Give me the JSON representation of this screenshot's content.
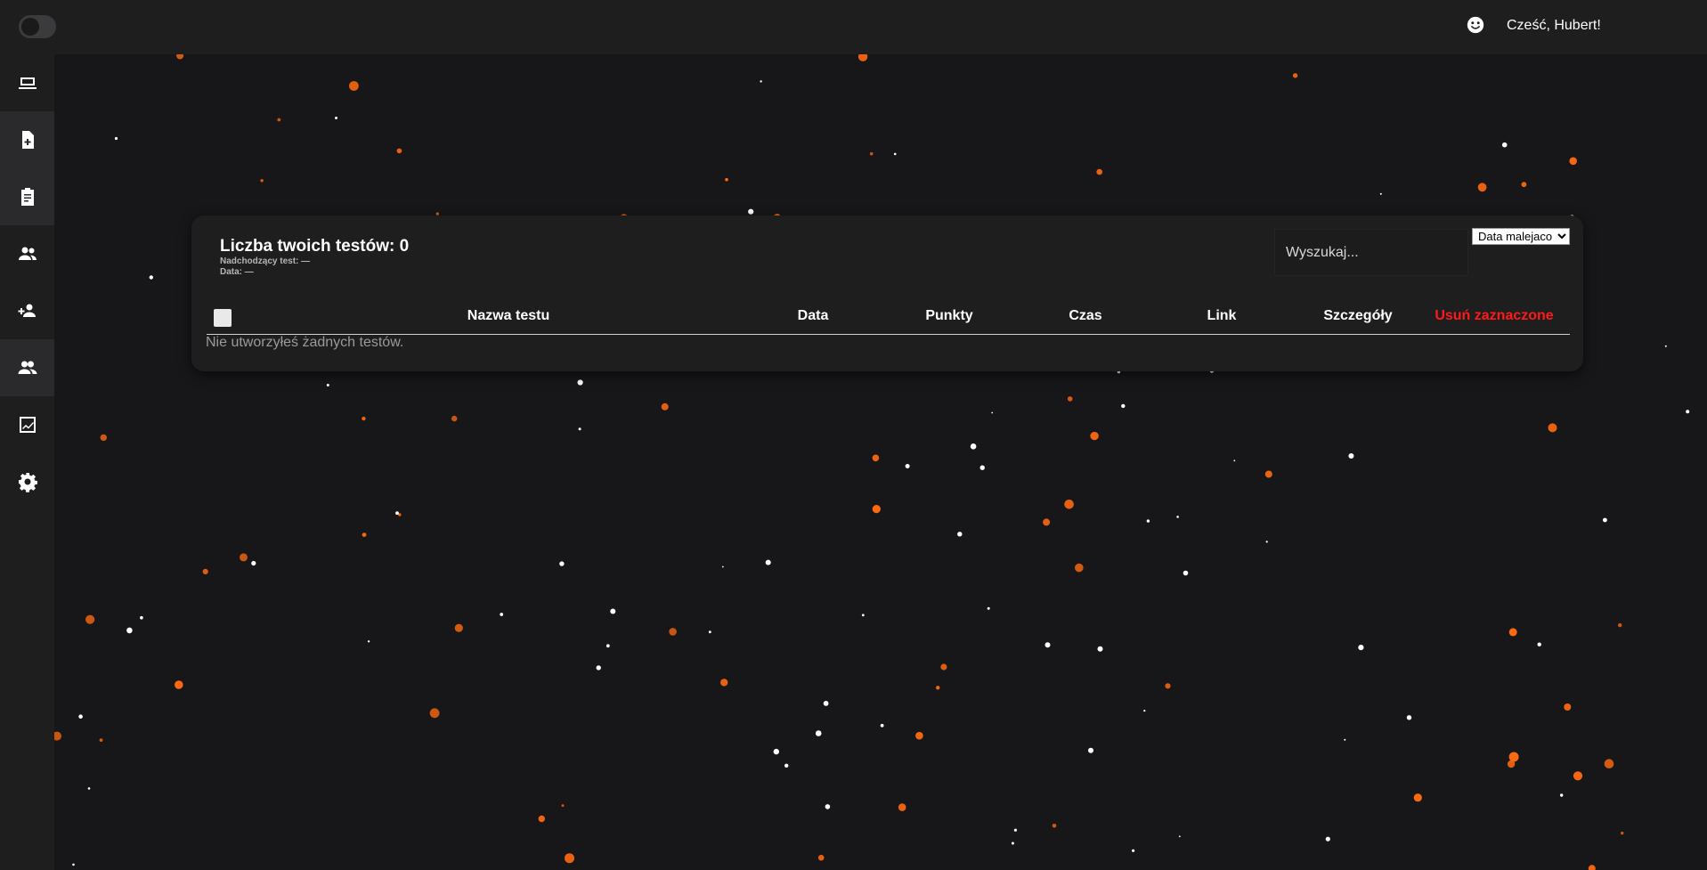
{
  "header": {
    "greeting": "Cześć, Hubert!"
  },
  "sidebar": {
    "items": [
      {
        "name": "dashboard",
        "icon": "laptop-icon"
      },
      {
        "name": "create-test",
        "icon": "file-plus-icon"
      },
      {
        "name": "tests",
        "icon": "clipboard-icon"
      },
      {
        "name": "groups",
        "icon": "users-icon"
      },
      {
        "name": "add-user",
        "icon": "user-plus-icon"
      },
      {
        "name": "students",
        "icon": "people-icon"
      },
      {
        "name": "statistics",
        "icon": "chart-icon"
      },
      {
        "name": "settings",
        "icon": "gear-icon"
      }
    ]
  },
  "panel": {
    "title": "Liczba twoich testów: 0",
    "upcoming": "Nadchodzący test: —",
    "date": "Data: —",
    "search_placeholder": "Wyszukaj...",
    "sort_selected": "Data malejaco",
    "columns": {
      "name": "Nazwa testu",
      "date": "Data",
      "points": "Punkty",
      "time": "Czas",
      "link": "Link",
      "details": "Szczegóły",
      "delete": "Usuń zaznaczone"
    },
    "empty_message": "Nie utworzyłeś żadnych testów."
  },
  "colors": {
    "background": "#17171a",
    "bar": "#1e1e1f",
    "danger": "#ff1a1a",
    "star_orange": "#ff6a10",
    "star_white": "#ffffff"
  }
}
